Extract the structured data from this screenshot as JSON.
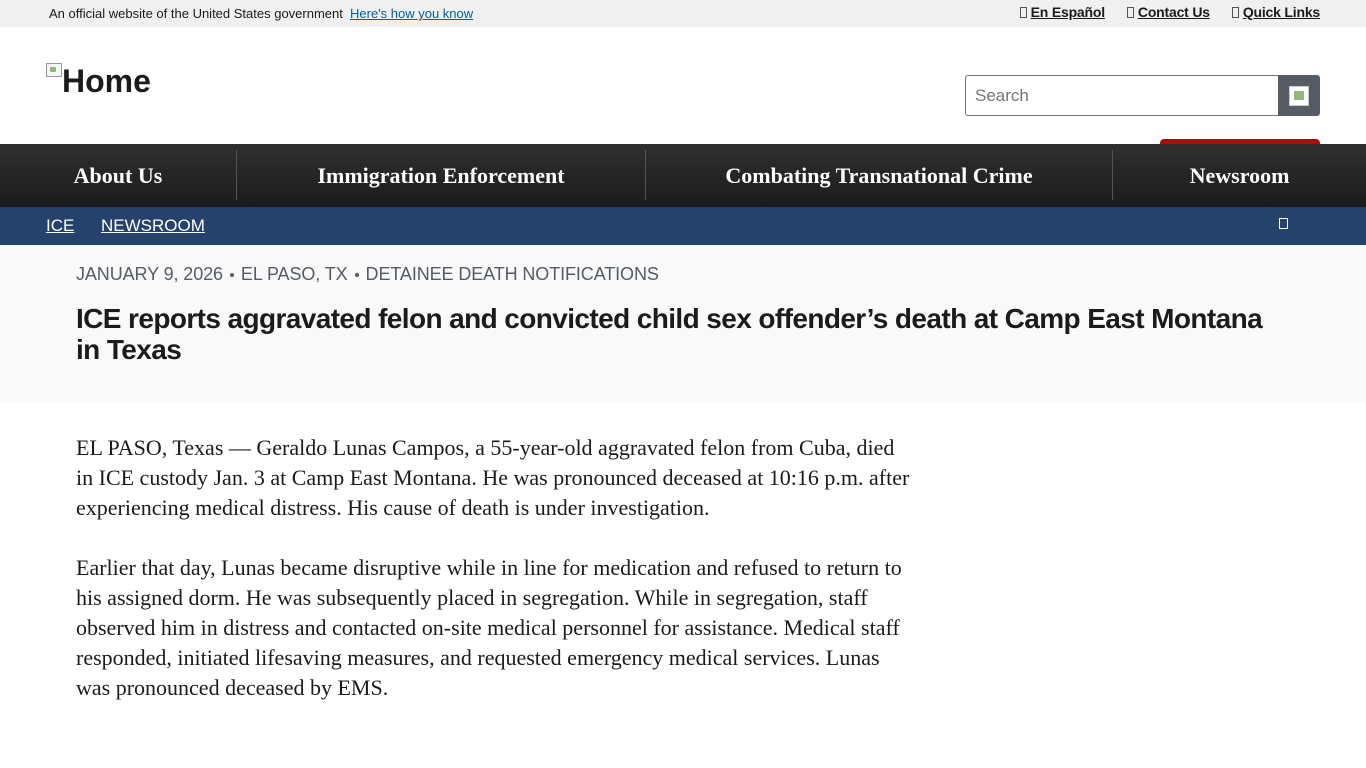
{
  "gov_banner": {
    "text": "An official website of the United States government",
    "link": "Here's how you know"
  },
  "utility_nav": [
    {
      "label": "En Español",
      "icon": "translate-icon"
    },
    {
      "label": "Contact Us",
      "icon": "envelope-icon"
    },
    {
      "label": "Quick Links",
      "icon": "link-icon"
    }
  ],
  "header": {
    "logo_alt": "Home",
    "search_placeholder": "Search"
  },
  "main_nav": [
    {
      "label": "About Us"
    },
    {
      "label": "Immigration Enforcement"
    },
    {
      "label": "Combating Transnational Crime"
    },
    {
      "label": "Newsroom"
    }
  ],
  "breadcrumb": [
    {
      "label": "ICE"
    },
    {
      "label": "NEWSROOM"
    }
  ],
  "article": {
    "meta": {
      "date": "JANUARY 9, 2026",
      "location": "EL PASO, TX",
      "category": "DETAINEE DEATH NOTIFICATIONS"
    },
    "title": "ICE reports aggravated felon and convicted child sex offender’s death at Camp East Montana in Texas",
    "paragraphs": [
      "EL PASO, Texas — Geraldo Lunas Campos, a 55-year-old aggravated felon from Cuba, died in ICE custody Jan. 3 at Camp East Montana. He was pronounced deceased at 10:16 p.m. after experiencing medical distress. His cause of death is under investigation.",
      "Earlier that day, Lunas became disruptive while in line for medication and refused to return to his assigned dorm. He was subsequently placed in segregation. While in segregation, staff observed him in distress and contacted on-site medical personnel for assistance. Medical staff responded, initiated lifesaving measures, and requested emergency medical services. Lunas was pronounced deceased by EMS."
    ]
  },
  "colors": {
    "gov_banner_bg": "#f0f0f0",
    "nav_bg": "#1c1c1c",
    "breadcrumb_bg": "#24426c",
    "accent_red": "#b50909",
    "link_blue": "#005ea2"
  }
}
